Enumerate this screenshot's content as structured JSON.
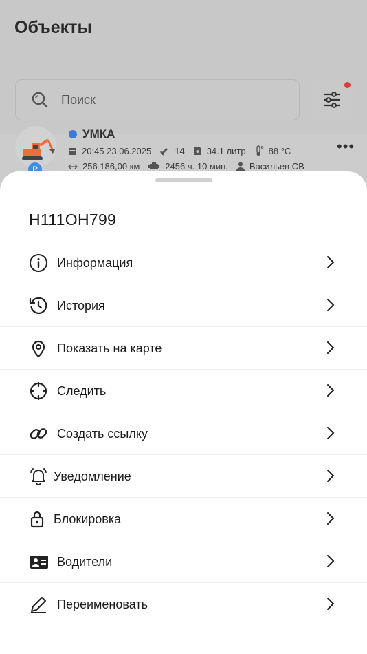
{
  "header": {
    "title": "Объекты"
  },
  "search": {
    "placeholder": "Поиск"
  },
  "object": {
    "name": "УМКА",
    "avatar_badge": "P",
    "time": "20:45 23.06.2025",
    "satellites": "14",
    "fuel": "34.1 литр",
    "temperature": "88 °С",
    "mileage": "256 186,00 км",
    "engine_hours": "2456 ч. 10 мин.",
    "driver": "Васильев СВ"
  },
  "sheet": {
    "title": "Н111ОН799",
    "items": [
      {
        "label": "Информация",
        "icon": "info-icon"
      },
      {
        "label": "История",
        "icon": "history-icon"
      },
      {
        "label": "Показать на карте",
        "icon": "map-pin-icon"
      },
      {
        "label": "Следить",
        "icon": "crosshair-icon"
      },
      {
        "label": "Создать ссылку",
        "icon": "link-icon"
      },
      {
        "label": "Уведомление",
        "icon": "bell-icon"
      },
      {
        "label": "Блокировка",
        "icon": "lock-icon"
      },
      {
        "label": "Водители",
        "icon": "id-card-icon"
      },
      {
        "label": "Переименовать",
        "icon": "pencil-icon"
      }
    ]
  },
  "colors": {
    "badge": "#3e8fe0",
    "notify_dot": "#e03b3b",
    "excavator": "#e8703a"
  }
}
